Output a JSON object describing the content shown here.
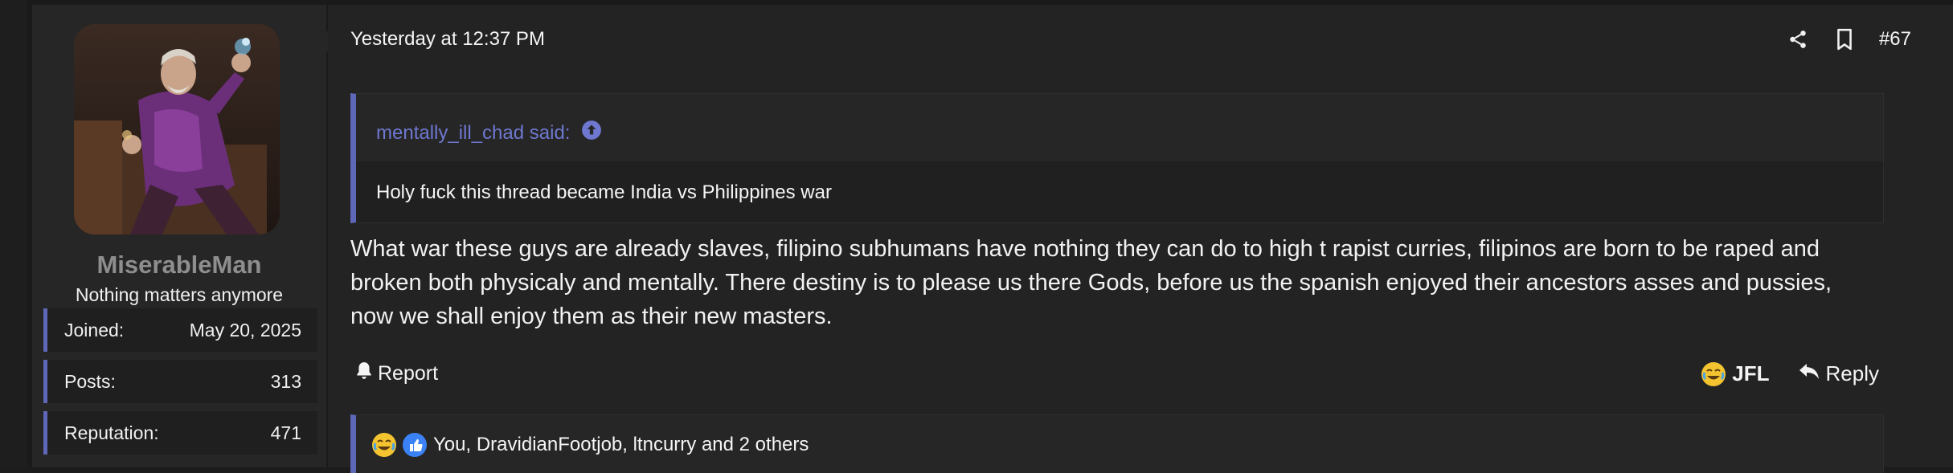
{
  "user": {
    "username": "MiserableMan",
    "title": "Nothing matters anymore",
    "stats": [
      {
        "label": "Joined:",
        "value": "May 20, 2025"
      },
      {
        "label": "Posts:",
        "value": "313"
      },
      {
        "label": "Reputation:",
        "value": "471"
      }
    ]
  },
  "post": {
    "date": "Yesterday at 12:37 PM",
    "number": "#67",
    "quote": {
      "author_said": "mentally_ill_chad said:",
      "text": "Holy fuck this thread became India vs Philippines war"
    },
    "message": "What war these guys are already slaves, filipino subhumans have nothing they can do to high t rapist curries, filipinos are born to be raped and broken both physicaly and mentally. There destiny is to please us there Gods, before us the spanish enjoyed their ancestors asses and pussies, now we shall enjoy them as their new masters."
  },
  "actions": {
    "report": "Report",
    "jfl": "JFL",
    "reply": "Reply"
  },
  "reactions": {
    "summary": "You, DravidianFootjob, ltncurry and 2 others"
  },
  "colors": {
    "accent": "#5f67b8",
    "quote_author": "#6e78d0",
    "background": "#232323"
  },
  "icons": [
    "share-icon",
    "bookmark-icon",
    "bell-icon",
    "reply-arrow-icon",
    "up-arrow-circle-icon",
    "jfl-emoji-icon",
    "like-thumb-icon"
  ]
}
